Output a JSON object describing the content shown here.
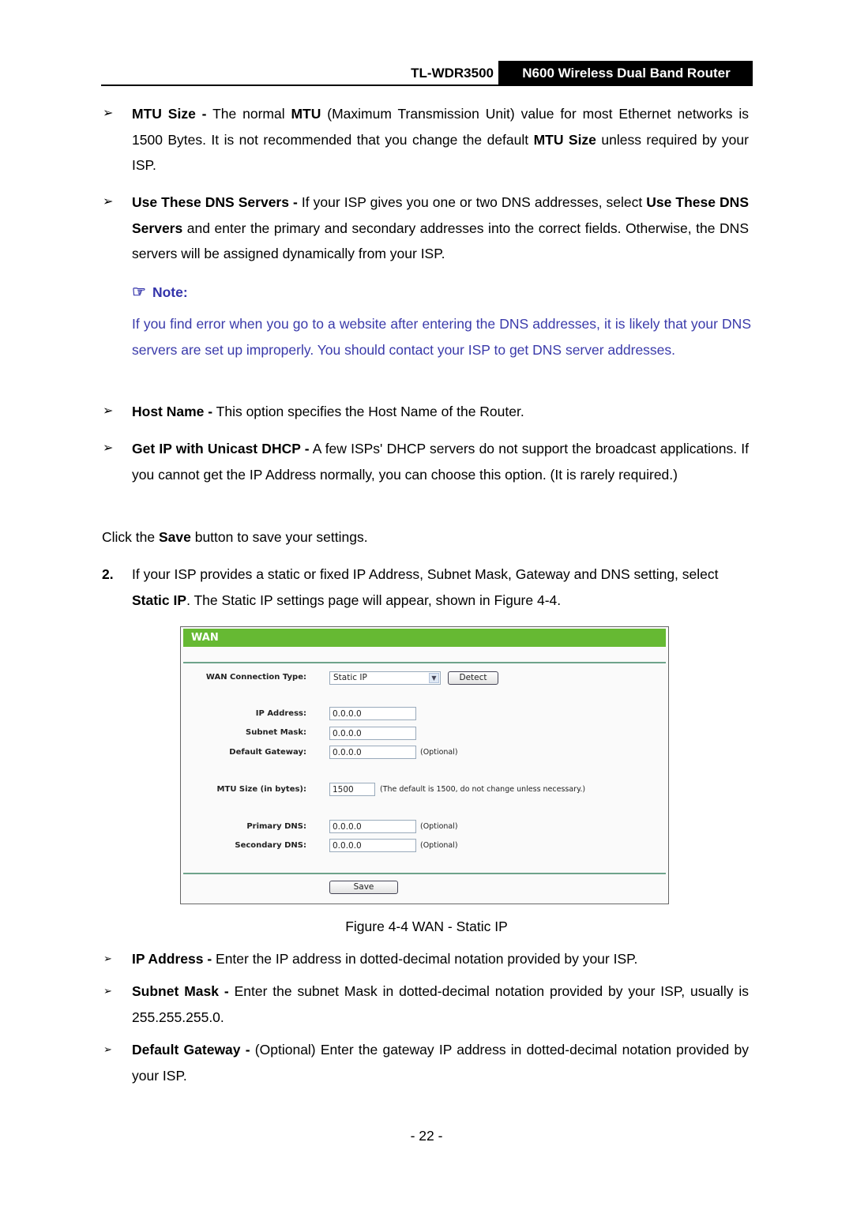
{
  "header": {
    "model": "TL-WDR3500",
    "product": "N600 Wireless Dual Band Router"
  },
  "bullets_top": [
    {
      "term": "MTU Size -",
      "text_parts": [
        " The normal ",
        "MTU",
        " (Maximum Transmission Unit) value for most Ethernet networks is 1500 Bytes. It is not recommended that you change the default ",
        "MTU Size",
        " unless required by your ISP."
      ]
    },
    {
      "term": "Use These DNS Servers -",
      "text_parts": [
        " If your ISP gives you one or two DNS addresses, select ",
        "Use These DNS Servers",
        " and enter the primary and secondary addresses into the correct fields. Otherwise, the DNS servers will be assigned dynamically from your ISP."
      ]
    }
  ],
  "note": {
    "icon": "pointing-hand-icon",
    "title": "Note:",
    "body": "If you find error when you go to a website after entering the DNS addresses, it is likely that your DNS servers are set up improperly. You should contact your ISP to get DNS server addresses."
  },
  "bullets_mid": [
    {
      "term": "Host Name -",
      "text": " This option specifies the Host Name of the Router."
    },
    {
      "term": "Get IP with Unicast DHCP -",
      "text": " A few ISPs' DHCP servers do not support the broadcast applications. If you cannot get the IP Address normally, you can choose this option. (It is rarely required.)"
    }
  ],
  "save_instruction": {
    "pre": "Click the ",
    "bold": "Save",
    "post": " button to save your settings."
  },
  "step2": {
    "number": "2.",
    "pre": "If your ISP provides a static or fixed IP Address, Subnet Mask, Gateway and DNS setting, select ",
    "bold": "Static IP",
    "post": ". The Static IP settings page will appear, shown in Figure 4-4."
  },
  "figure": {
    "title": "WAN",
    "connection_type_label": "WAN Connection Type:",
    "connection_type_value": "Static IP",
    "detect_label": "Detect",
    "fields": [
      {
        "label": "IP Address:",
        "value": "0.0.0.0",
        "hint": ""
      },
      {
        "label": "Subnet Mask:",
        "value": "0.0.0.0",
        "hint": ""
      },
      {
        "label": "Default Gateway:",
        "value": "0.0.0.0",
        "hint": "(Optional)"
      },
      {
        "label": "MTU Size (in bytes):",
        "value": "1500",
        "hint": "(The default is 1500, do not change unless necessary.)"
      },
      {
        "label": "Primary DNS:",
        "value": "0.0.0.0",
        "hint": "(Optional)"
      },
      {
        "label": "Secondary DNS:",
        "value": "0.0.0.0",
        "hint": "(Optional)"
      }
    ],
    "save_label": "Save",
    "caption": "Figure 4-4 WAN - Static IP"
  },
  "bullets_bottom": [
    {
      "term": "IP Address -",
      "text": " Enter the IP address in dotted-decimal notation provided by your ISP."
    },
    {
      "term": "Subnet Mask -",
      "text": " Enter the subnet Mask in dotted-decimal notation provided by your ISP, usually is 255.255.255.0."
    },
    {
      "term": "Default Gateway -",
      "text": " (Optional) Enter the gateway IP address in dotted-decimal notation provided by your ISP."
    }
  ],
  "bullet_glyph": "➢",
  "bullet_glyph_small": "➢",
  "page_number": "- 22 -"
}
